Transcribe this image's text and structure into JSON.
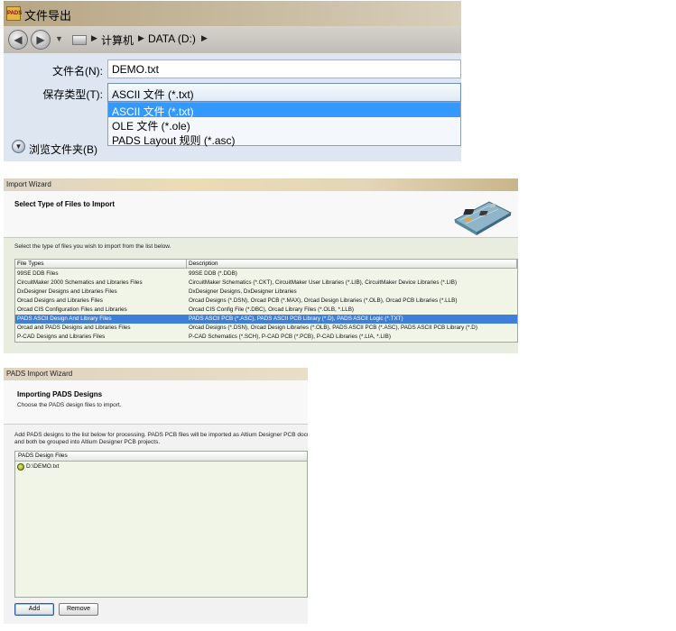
{
  "save_dialog": {
    "title": "文件导出",
    "logo_text": "PADS",
    "breadcrumbs": [
      "计算机",
      "DATA (D:)"
    ],
    "filename_label": "文件名(N):",
    "filename_value": "DEMO.txt",
    "filetype_label": "保存类型(T):",
    "filetype_value": "ASCII 文件 (*.txt)",
    "filetype_options": [
      "ASCII 文件 (*.txt)",
      "OLE 文件 (*.ole)",
      "PADS Layout 规则 (*.asc)"
    ],
    "browse_label": "浏览文件夹(B)"
  },
  "import_wizard": {
    "title": "Import Wizard",
    "heading": "Select Type of Files to Import",
    "instruction": "Select the type of files you wish to import from the list below.",
    "columns": [
      "File Types",
      "Description"
    ],
    "rows": [
      {
        "type": "99SE DDB Files",
        "desc": "99SE DDB (*.DDB)"
      },
      {
        "type": "CircuitMaker 2000 Schematics and Libraries Files",
        "desc": "CircuitMaker Schematics (*.CKT), CircuitMaker User Libraries (*.LIB), CircuitMaker Device Libraries (*.LIB)"
      },
      {
        "type": "DxDesigner Designs and Libraries Files",
        "desc": "DxDesigner Designs, DxDesigner Libraries"
      },
      {
        "type": "Orcad Designs and Libraries Files",
        "desc": "Orcad Designs (*.DSN), Orcad PCB (*.MAX), Orcad Design Libraries (*.OLB), Orcad PCB Libraries (*.LLB)"
      },
      {
        "type": "Orcad CIS Configuration Files and Libraries",
        "desc": "Orcad CIS Config File (*.DBC), Orcad Library Files (*.OLB, *.LLB)"
      },
      {
        "type": "PADS ASCII Design And Library Files",
        "desc": "PADS ASCII PCB (*.ASC), PADS ASCII PCB Library (*.D), PADS ASCII Logic (*.TXT)"
      },
      {
        "type": "Orcad and PADS Designs and Libraries Files",
        "desc": "Orcad Designs (*.DSN), Orcad Design Libraries (*.OLB), PADS ASCII PCB (*.ASC), PADS ASCII PCB Library (*.D)"
      },
      {
        "type": "P-CAD Designs and Libraries Files",
        "desc": "P-CAD Schematics (*.SCH), P-CAD PCB (*.PCB), P-CAD Libraries (*.LIA, *.LIB)"
      }
    ],
    "selected_row": 5
  },
  "pads_wizard": {
    "title": "PADS Import Wizard",
    "heading": "Importing PADS Designs",
    "subheading": "Choose the PADS design files to import.",
    "description_line1": "Add PADS designs to the list below for processing. PADS PCB files will be imported as Altium Designer PCB docume",
    "description_line2": "and both be grouped into Altium Designer PCB projects.",
    "list_header": "PADS Design Files",
    "files": [
      "D:\\DEMO.txt"
    ],
    "add_label": "Add",
    "remove_label": "Remove"
  },
  "colors": {
    "selection": "#3399ff",
    "list_bg": "#f0f5e7",
    "dialog_bg": "#dee7f1"
  }
}
